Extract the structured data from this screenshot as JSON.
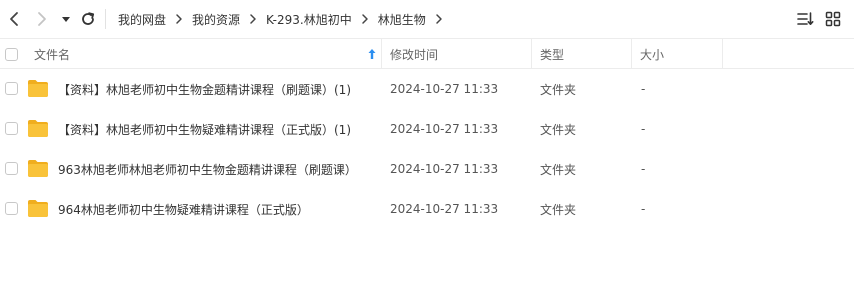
{
  "nav": {
    "icons": [
      "back-arrow-icon",
      "forward-arrow-icon",
      "dropdown-caret-icon",
      "refresh-icon"
    ],
    "breadcrumb": [
      "我的网盘",
      "我的资源",
      "K-293.林旭初中",
      "林旭生物"
    ]
  },
  "toolbar": {
    "icons": [
      "sort-list-icon",
      "grid-view-icon"
    ]
  },
  "table": {
    "headers": {
      "name": "文件名",
      "modified": "修改时间",
      "type": "类型",
      "size": "大小"
    },
    "sort_column": "name",
    "sort_direction": "ascending",
    "rows": [
      {
        "name": "【资料】林旭老师初中生物金题精讲课程（刷题课）(1)",
        "modified": "2024-10-27 11:33",
        "type": "文件夹",
        "size": "-"
      },
      {
        "name": "【资料】林旭老师初中生物疑难精讲课程（正式版）(1)",
        "modified": "2024-10-27 11:33",
        "type": "文件夹",
        "size": "-"
      },
      {
        "name": "963林旭老师林旭老师初中生物金题精讲课程（刷题课）",
        "modified": "2024-10-27 11:33",
        "type": "文件夹",
        "size": "-"
      },
      {
        "name": "964林旭老师初中生物疑难精讲课程（正式版）",
        "modified": "2024-10-27 11:33",
        "type": "文件夹",
        "size": "-"
      }
    ]
  },
  "colors": {
    "folder": "#F9C33A",
    "folder_dark": "#F0AE1E",
    "accent": "#2b8ef0",
    "border": "#ececec"
  }
}
